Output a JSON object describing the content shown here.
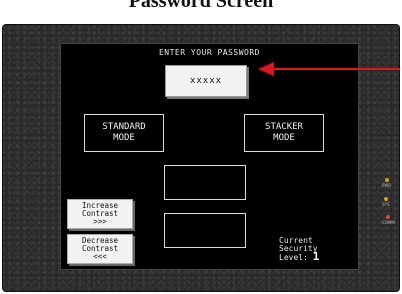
{
  "page_title": "Password Screen",
  "screen": {
    "header": "ENTER YOUR PASSWORD",
    "password_value": "xxxxx",
    "standard_mode": {
      "line1": "STANDARD",
      "line2": "MODE"
    },
    "stacker_mode": {
      "line1": "STACKER",
      "line2": "MODE"
    },
    "increase_contrast": {
      "line1": "Increase",
      "line2": "Contrast",
      "line3": ">>>"
    },
    "decrease_contrast": {
      "line1": "Decrease",
      "line2": "Contrast",
      "line3": "<<<"
    },
    "security": {
      "line1": "Current",
      "line2": "Security",
      "line3": "Level:",
      "level": "1"
    }
  },
  "indicators": [
    {
      "label": "PWR",
      "color": "#d4a017"
    },
    {
      "label": "SYS",
      "color": "#d4a017"
    },
    {
      "label": "COMM",
      "color": "#d94a2a"
    }
  ],
  "annotation": {
    "arrow_color": "#e0141e"
  }
}
